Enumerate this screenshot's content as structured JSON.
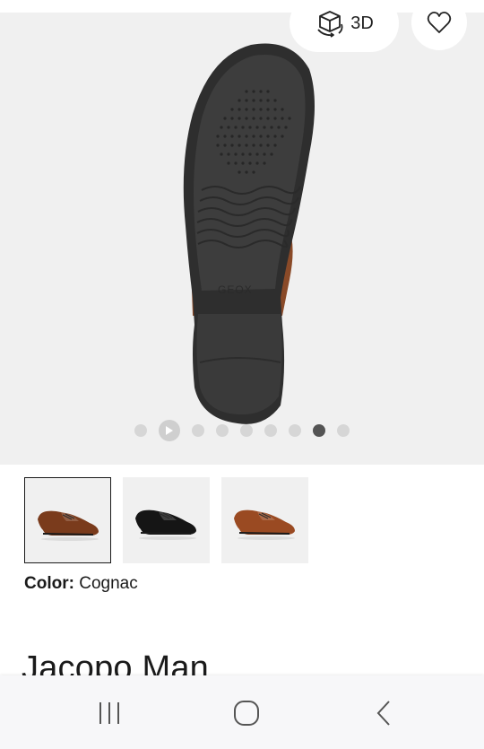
{
  "header": {
    "view3d_label": "3D",
    "view3d_icon": "cube-3d-icon",
    "favorite_icon": "heart-icon"
  },
  "gallery": {
    "image_count": 9,
    "active_index": 7,
    "play_index": 1,
    "sole_brand_text": "GEOX"
  },
  "thumbnails": [
    {
      "name": "cognac",
      "shoe_color": "#7a3b1c",
      "selected": true
    },
    {
      "name": "black",
      "shoe_color": "#151515",
      "selected": false
    },
    {
      "name": "light-brown",
      "shoe_color": "#9a4a22",
      "selected": false
    }
  ],
  "product": {
    "color_key": "Color:",
    "color_value": " Cognac",
    "title": "Jacopo Man"
  },
  "navbar": {
    "recents_icon": "recents-icon",
    "home_icon": "home-icon",
    "back_icon": "back-icon"
  },
  "colors": {
    "gallery_bg": "#f0f0f0",
    "dot_active": "#545454",
    "dot_inactive": "#d6d6d6"
  }
}
